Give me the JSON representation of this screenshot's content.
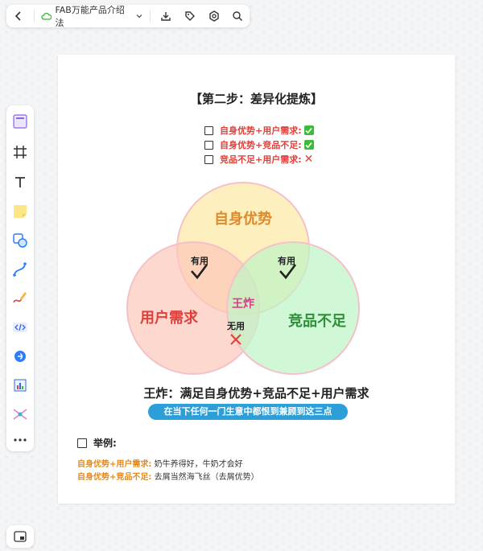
{
  "toolbar": {
    "back": "back",
    "doc_title": "FAB万能产品介绍法",
    "icons": [
      "download-icon",
      "tag-icon",
      "settings-icon",
      "search-icon"
    ]
  },
  "sidebar": {
    "tools": [
      "template",
      "frame",
      "text",
      "sticky-note",
      "shape",
      "connector",
      "pen",
      "code",
      "mindmap",
      "table",
      "flow",
      "more"
    ]
  },
  "board": {
    "step_title": "【第二步：差异化提炼】",
    "checks": [
      {
        "label": "自身优势+用户需求:",
        "result": "ok"
      },
      {
        "label": "自身优势+竞品不足:",
        "result": "ok"
      },
      {
        "label": "竞品不足+用户需求:",
        "result": "no"
      }
    ],
    "venn": {
      "top": "自身优势",
      "left": "用户需求",
      "right": "竞品不足",
      "useful_left": "有用",
      "useful_right": "有用",
      "center": "王炸",
      "useless": "无用",
      "colors": {
        "top": "#fde9a9",
        "left": "#fcc7bb",
        "right": "#bdf5c4"
      }
    },
    "summary": "王炸：满足自身优势+竞品不足+用户需求",
    "pill": "在当下任何一门生意中都恨到兼顾到这三点",
    "example_head": "举例:",
    "examples": [
      {
        "key": "自身优势+用户需求:",
        "text": "奶牛养得好，牛奶才会好"
      },
      {
        "key": "自身优势+竞品不足:",
        "text": "去屑当然海飞丝（去屑优势）"
      }
    ]
  }
}
